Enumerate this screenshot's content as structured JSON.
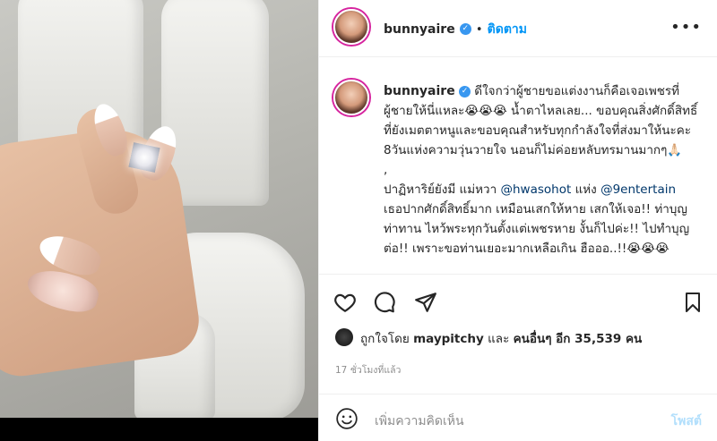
{
  "header": {
    "username": "bunnyaire",
    "follow_label": "ติดตาม"
  },
  "caption": {
    "username": "bunnyaire",
    "line1": "ดีใจกว่าผู้ชายขอแต่งงานก็คือเจอเพชรที่ผู้ชายให้นี่แหละ😭😭😭 น้ำตาไหลเลย... ขอบคุณสิ่งศักดิ์สิทธิ์ที่ยังเมตตาหนูและขอบคุณสำหรับทุกกำลังใจที่ส่งมาให้นะคะ 8วันแห่งความวุ่นวายใจ นอนก็ไม่ค่อยหลับทรมานมากๆ🙏🏻",
    "line2": ",",
    "line3_pre": "ปาฏิหาริย์ยังมี แม่หวา ",
    "mention1": "@hwasohot",
    "line3_mid": " แห่ง ",
    "mention2": "@9entertain",
    "line4": "เธอปากศักดิ์สิทธิ์มาก เหมือนเสกให้หาย เสกให้เจอ!! ท่าบุญ ท่าทาน ไหว้พระทุกวันตั้งแต่เพชรหาย งั้นก็ไปค่ะ!! ไปทำบุญต่อ!! เพราะขอท่านเยอะมากเหลือเกิน ฮือออ..!!😭😭😭"
  },
  "likes": {
    "prefix": "ถูกใจโดย",
    "user": "maypitchy",
    "middle": "และ",
    "others": "คนอื่นๆ อีก 35,539 คน"
  },
  "timestamp": "17 ชั่วโมงที่แล้ว",
  "comment": {
    "placeholder": "เพิ่มความคิดเห็น",
    "post_label": "โพสต์"
  },
  "icons": {
    "like": "heart-icon",
    "comment": "comment-icon",
    "share": "share-icon",
    "save": "bookmark-icon",
    "emoji": "emoji-icon",
    "more": "more-icon"
  },
  "colors": {
    "link": "#0095f6",
    "mention": "#00376b",
    "muted": "#8e8e8e",
    "border": "#efefef"
  }
}
